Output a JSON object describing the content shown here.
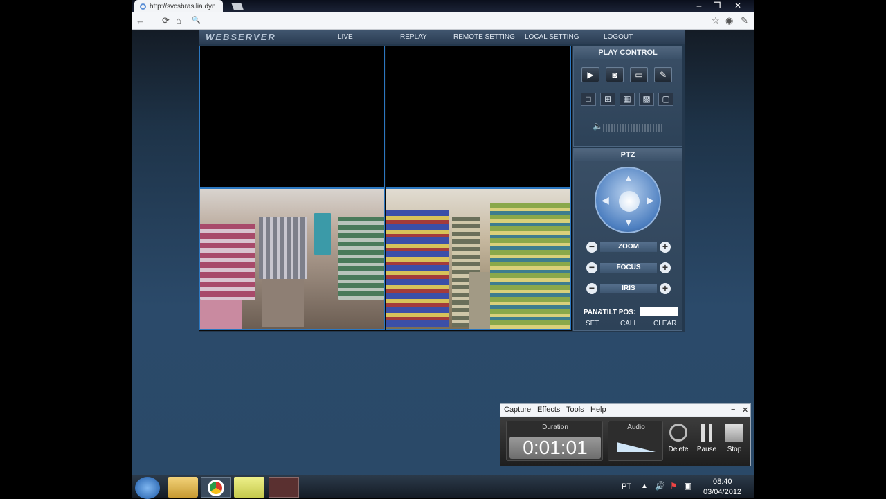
{
  "browser": {
    "tab_title": "http://svcsbrasilia.dyn",
    "address": "",
    "window_controls": [
      "–",
      "❐",
      "✕"
    ]
  },
  "app": {
    "logo": "WEBSERVER",
    "nav": [
      "LIVE",
      "REPLAY",
      "REMOTE SETTING",
      "LOCAL SETTING",
      "LOGOUT"
    ]
  },
  "play_control": {
    "title": "PLAY CONTROL",
    "buttons": [
      "play-icon",
      "snapshot-icon",
      "record-icon",
      "talk-icon"
    ],
    "layouts": [
      "layout-1-icon",
      "layout-4-icon",
      "layout-9-icon",
      "layout-16-icon",
      "fullscreen-icon"
    ]
  },
  "ptz": {
    "title": "PTZ",
    "zoom": "ZOOM",
    "focus": "FOCUS",
    "iris": "IRIS",
    "pan_tilt_label": "PAN&TILT POS:",
    "set": "SET",
    "call": "CALL",
    "clear": "CLEAR"
  },
  "capture": {
    "menu": [
      "Capture",
      "Effects",
      "Tools",
      "Help"
    ],
    "duration_label": "Duration",
    "duration": "0:01:01",
    "audio_label": "Audio",
    "audio_level": 0.6,
    "delete": "Delete",
    "pause": "Pause",
    "stop": "Stop"
  },
  "taskbar": {
    "lang": "PT",
    "time": "08:40",
    "date": "03/04/2012"
  }
}
